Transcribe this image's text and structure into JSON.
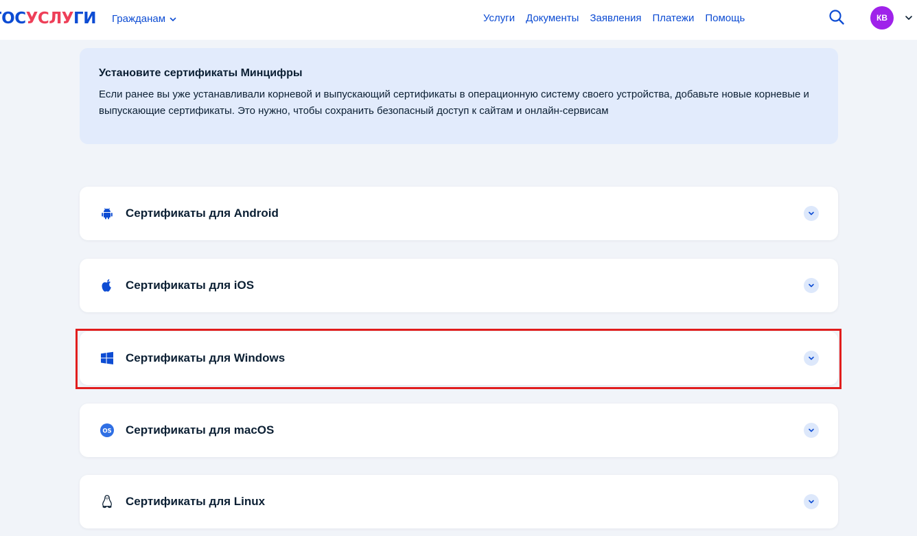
{
  "header": {
    "logo": {
      "part1": "ГОС",
      "part2": "УСЛУ",
      "part3": "ГИ"
    },
    "citizens_label": "Гражданам",
    "nav": [
      "Услуги",
      "Документы",
      "Заявления",
      "Платежи",
      "Помощь"
    ],
    "search_icon": "search-icon",
    "avatar_initials": "КВ"
  },
  "banner": {
    "title": "Установите сертификаты Минцифры",
    "text": "Если ранее вы уже устанавливали корневой и выпускающий сертификаты в операционную систему своего устройства, добавьте новые корневые и выпускающие сертификаты. Это нужно, чтобы сохранить безопасный доступ к сайтам и онлайн-сервисам"
  },
  "accordion": [
    {
      "label": "Сертификаты для Android",
      "icon": "android-icon"
    },
    {
      "label": "Сертификаты для iOS",
      "icon": "apple-icon"
    },
    {
      "label": "Сертификаты для Windows",
      "icon": "windows-icon",
      "highlighted": true
    },
    {
      "label": "Сертификаты для macOS",
      "icon": "macos-icon",
      "icon_text": "OS"
    },
    {
      "label": "Сертификаты для Linux",
      "icon": "linux-icon"
    }
  ],
  "colors": {
    "brand_blue": "#0d4cd3",
    "brand_red": "#ee3f58",
    "avatar": "#9f22ea",
    "banner_bg": "#e2ebfc",
    "highlight": "#e11d1d"
  }
}
